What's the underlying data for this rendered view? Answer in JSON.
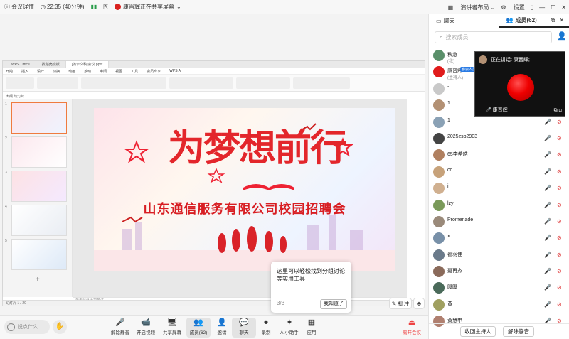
{
  "topbar": {
    "meeting_info": "会议详情",
    "time": "22:35 (40分钟)",
    "sharing_status": "康晋辉正在共享屏幕",
    "layout": "演讲者布局",
    "settings": "设置"
  },
  "ppt": {
    "tabs": [
      "WPS Office",
      "找稻壳模板",
      "[演示文稿]会议.pptx"
    ],
    "menu": [
      "开始",
      "插入",
      "设计",
      "切换",
      "动画",
      "放映",
      "审阅",
      "视图",
      "工具",
      "会员专享",
      "WPS AI"
    ],
    "active_menu": "开始",
    "pane_tabs": "大纲  幻灯片",
    "slide_numbers": [
      "1",
      "2",
      "3",
      "4",
      "5"
    ],
    "slide_title": "为梦想前行",
    "slide_subtitle": "山东通信服务有限公司校园招聘会",
    "notes": "单击此处添加备注",
    "status": "幻灯片 1 / 20"
  },
  "tip": {
    "text": "这里可以轻松找到分组讨论等实用工具",
    "count": "3/3",
    "ok": "我知道了"
  },
  "floating": {
    "annotate": "批注"
  },
  "bottombar": {
    "chat_placeholder": "说点什么...",
    "buttons": [
      {
        "label": "解除静音",
        "icon": "🎤"
      },
      {
        "label": "开启视频",
        "icon": "📹"
      },
      {
        "label": "共享屏幕",
        "icon": "🖥"
      },
      {
        "label": "成员(62)",
        "icon": "👥"
      },
      {
        "label": "邀请",
        "icon": "👤"
      },
      {
        "label": "聊天",
        "icon": "💬"
      },
      {
        "label": "录制",
        "icon": "⏺"
      },
      {
        "label": "AI小助手",
        "icon": "✦"
      },
      {
        "label": "应用",
        "icon": "▦"
      }
    ],
    "leave": "离开会议"
  },
  "rpanel": {
    "tab_chat": "聊天",
    "tab_members": "成员(62)",
    "search_placeholder": "搜索成员",
    "members": [
      {
        "name": "秋急",
        "role": "(我)",
        "color": "#5a8f6a"
      },
      {
        "name": "康晋辉",
        "role": "(主持人)",
        "color": "#e01b1b",
        "badge": "参会人员"
      },
      {
        "name": "-",
        "role": "",
        "color": "#c9c9c9"
      },
      {
        "name": "1",
        "role": "",
        "color": "#b39174"
      },
      {
        "name": "1",
        "role": "",
        "color": "#8aa1b5"
      },
      {
        "name": "2025zsb2903",
        "role": "",
        "color": "#444"
      },
      {
        "name": "65李希皓",
        "role": "",
        "color": "#b08060"
      },
      {
        "name": "cc",
        "role": "",
        "color": "#c7a27a"
      },
      {
        "name": "i",
        "role": "",
        "color": "#d0b090"
      },
      {
        "name": "lzy",
        "role": "",
        "color": "#7a9a5a"
      },
      {
        "name": "Promenade",
        "role": "",
        "color": "#9a8a7a"
      },
      {
        "name": "x",
        "role": "",
        "color": "#7890a8"
      },
      {
        "name": "翟羽佳",
        "role": "",
        "color": "#6a7a8a"
      },
      {
        "name": "聂再杰",
        "role": "",
        "color": "#8a6a5a"
      },
      {
        "name": "曝曝",
        "role": "",
        "color": "#4a6a5a"
      },
      {
        "name": "黄",
        "role": "",
        "color": "#a0a060"
      },
      {
        "name": "黄慧申",
        "role": "",
        "color": "#b08070"
      }
    ],
    "recall_host": "收回主持人",
    "unmute_all": "解除静音"
  },
  "speaker": {
    "title": "正在讲话: 康晋辉;",
    "name": "康晋辉"
  }
}
